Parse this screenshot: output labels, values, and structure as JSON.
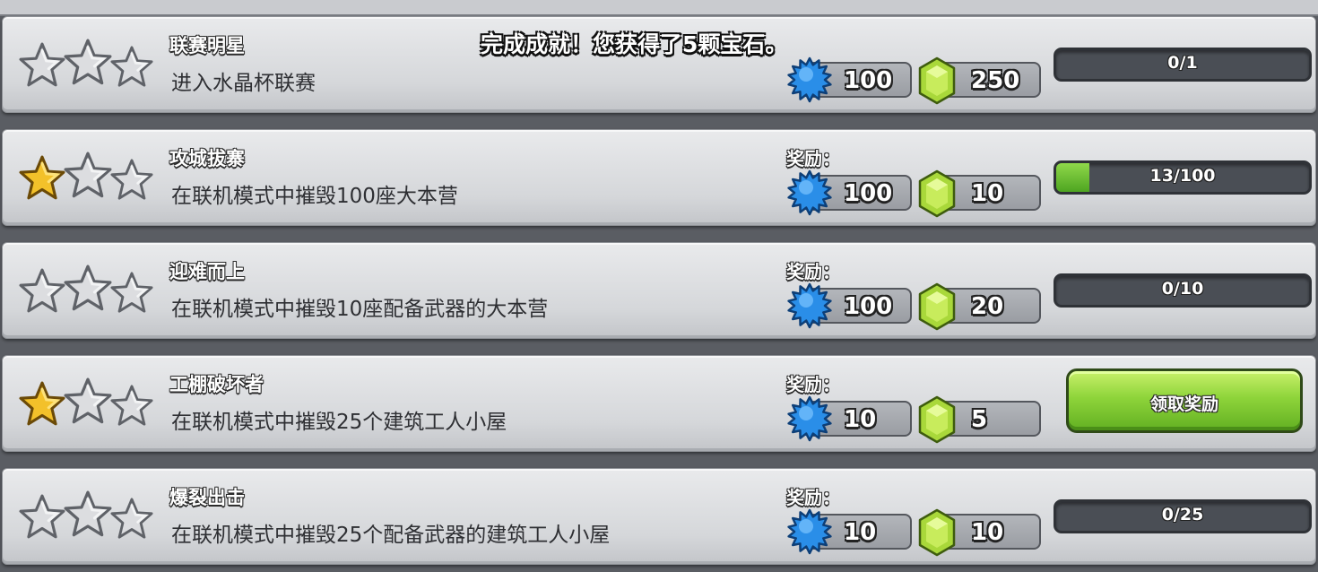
{
  "notification": "完成成就！您获得了5颗宝石。",
  "icons": {
    "star_filled": "star-filled-icon",
    "star_empty": "star-empty-icon",
    "experience": "blue-experience-star-icon",
    "gem": "green-gem-icon"
  },
  "colors": {
    "progress_fill": "#5fbf2a",
    "claim_button": "#8ed43a",
    "star_gold": "#f3c12a",
    "xp_blue": "#2a8ee8",
    "gem_green": "#a9d83a"
  },
  "achievements": [
    {
      "title": "联赛明星",
      "description": "进入水晶杯联赛",
      "reward_label": "",
      "stars_earned": 0,
      "xp_reward": "100",
      "gem_reward": "250",
      "progress_text": "0/1",
      "progress_fraction": 0,
      "claim_label": ""
    },
    {
      "title": "攻城拔寨",
      "description": "在联机模式中摧毁100座大本营",
      "reward_label": "奖励：",
      "stars_earned": 1,
      "xp_reward": "100",
      "gem_reward": "10",
      "progress_text": "13/100",
      "progress_fraction": 0.13,
      "claim_label": ""
    },
    {
      "title": "迎难而上",
      "description": "在联机模式中摧毁10座配备武器的大本营",
      "reward_label": "奖励：",
      "stars_earned": 0,
      "xp_reward": "100",
      "gem_reward": "20",
      "progress_text": "0/10",
      "progress_fraction": 0,
      "claim_label": ""
    },
    {
      "title": "工棚破坏者",
      "description": "在联机模式中摧毁25个建筑工人小屋",
      "reward_label": "奖励：",
      "stars_earned": 1,
      "xp_reward": "10",
      "gem_reward": "5",
      "progress_text": "",
      "progress_fraction": null,
      "claim_label": "领取奖励"
    },
    {
      "title": "爆裂出击",
      "description": "在联机模式中摧毁25个配备武器的建筑工人小屋",
      "reward_label": "奖励：",
      "stars_earned": 0,
      "xp_reward": "10",
      "gem_reward": "10",
      "progress_text": "0/25",
      "progress_fraction": 0,
      "claim_label": ""
    }
  ]
}
